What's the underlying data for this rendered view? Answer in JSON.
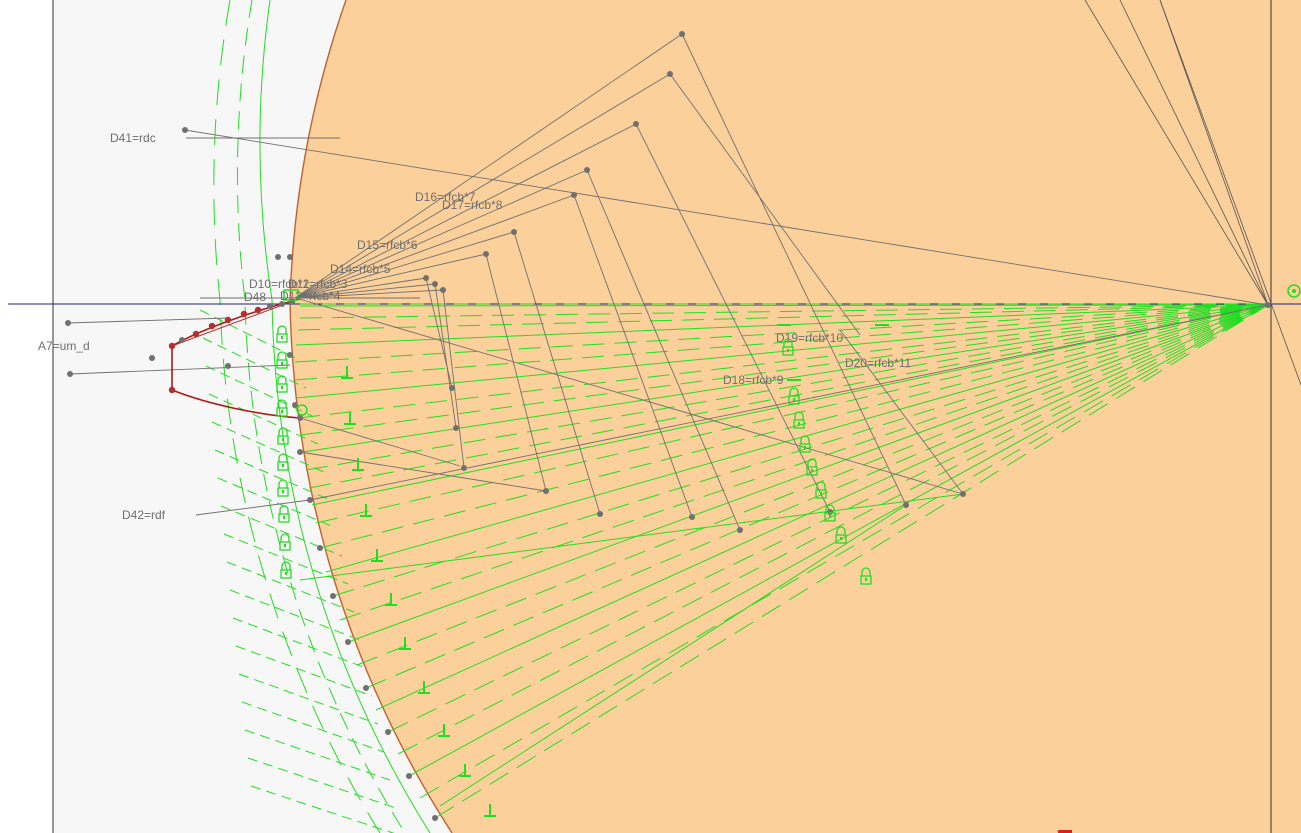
{
  "viewport": {
    "background": "#f7f7f7",
    "fill_color": "#fcd09a",
    "profile_color": "#c06030",
    "root_profile_color": "#b01818",
    "construction_color": "#22dd22",
    "dimension_color": "#707070",
    "axis_color": "#202070"
  },
  "dimensions": [
    {
      "id": "d41",
      "label": "D41=rdc"
    },
    {
      "id": "a7",
      "label": "A7=um_d"
    },
    {
      "id": "d42",
      "label": "D42=rdf"
    },
    {
      "id": "d16",
      "label": "D16=rfcb*7"
    },
    {
      "id": "d17",
      "label": "D17=rfcb*8"
    },
    {
      "id": "d15",
      "label": "D15=rfcb*6"
    },
    {
      "id": "d14",
      "label": "D14=rfcb*5"
    },
    {
      "id": "d10",
      "label": "D10=rfcb*2"
    },
    {
      "id": "d11",
      "label": "D11=rfcb*3"
    },
    {
      "id": "d48",
      "label": "D48"
    },
    {
      "id": "d12",
      "label": "D12=rfcb*4"
    },
    {
      "id": "d19",
      "label": "D19=rfcb*10"
    },
    {
      "id": "d20",
      "label": "D20=rfcb*11"
    },
    {
      "id": "d18",
      "label": "D18=rfcb*9"
    }
  ],
  "icons": {
    "lock": "lock-constraint-icon",
    "perpendicular": "perpendicular-constraint-icon",
    "horizontal": "horizontal-constraint-icon",
    "origin": "origin-marker-icon"
  }
}
